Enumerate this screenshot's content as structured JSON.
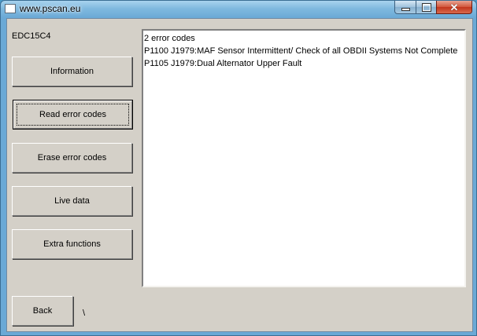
{
  "window": {
    "title": "www.pscan.eu",
    "close_symbol": "✕"
  },
  "ecu": {
    "name": "EDC15C4"
  },
  "buttons": {
    "information": "Information",
    "read_error_codes": "Read error codes",
    "erase_error_codes": "Erase error codes",
    "live_data": "Live data",
    "extra_functions": "Extra functions",
    "back": "Back"
  },
  "output": {
    "lines": [
      "2 error codes",
      "P1100 J1979:MAF Sensor Intermittent/ Check of all OBDII Systems Not Complete",
      "P1105 J1979:Dual Alternator Upper Fault"
    ]
  },
  "status": {
    "text": "\\"
  },
  "icons": {
    "app": "app-window-icon",
    "minimize": "minimize-icon",
    "maximize": "maximize-icon",
    "close": "close-icon"
  }
}
